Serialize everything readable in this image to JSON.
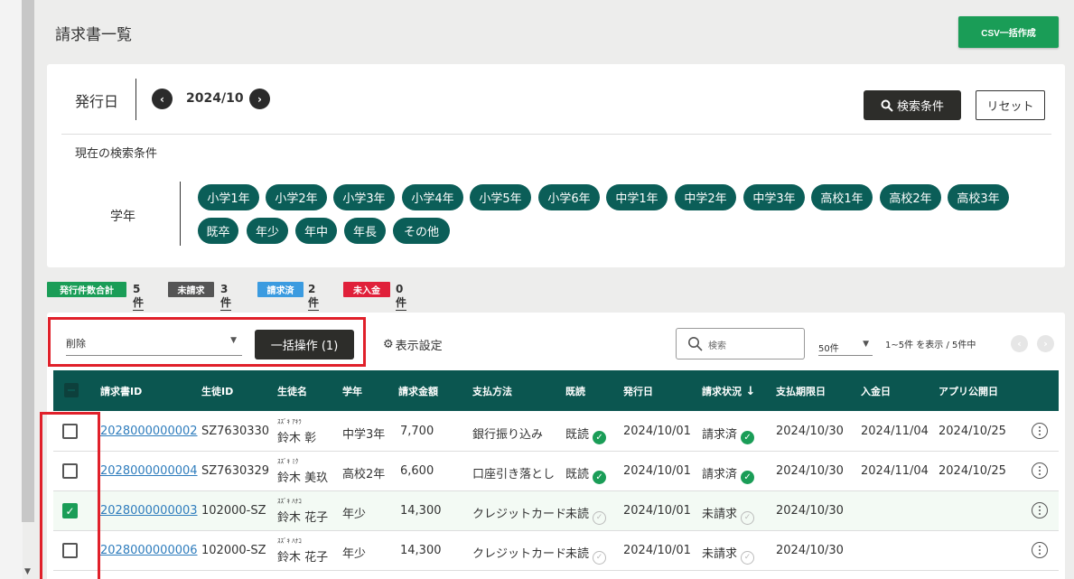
{
  "page": {
    "title": "請求書一覧",
    "csv_button": "CSV一括作成"
  },
  "search": {
    "date_label": "発行日",
    "current_date": "2024/10",
    "search_button": "検索条件",
    "reset_button": "リセット",
    "conditions_label": "現在の検索条件",
    "grade_label": "学年",
    "grade_chips": [
      "小学1年",
      "小学2年",
      "小学3年",
      "小学4年",
      "小学5年",
      "小学6年",
      "中学1年",
      "中学2年",
      "中学3年",
      "高校1年",
      "高校2年",
      "高校3年",
      "既卒",
      "年少",
      "年中",
      "年長",
      "その他"
    ]
  },
  "summary": [
    {
      "label": "発行件数合計",
      "count": "5件",
      "color": "#1a9d57"
    },
    {
      "label": "未請求",
      "count": "3件",
      "color": "#555555"
    },
    {
      "label": "請求済",
      "count": "2件",
      "color": "#3b9be0"
    },
    {
      "label": "未入金",
      "count": "0件",
      "color": "#e0203a"
    }
  ],
  "toolbar": {
    "bulk_select_value": "削除",
    "bulk_button": "一括操作 (1)",
    "display_settings": "表示設定",
    "search_placeholder": "検索",
    "per_page": "50件",
    "range_text": "1~5件 を表示 / 5件中"
  },
  "table": {
    "headers": [
      "請求書ID",
      "生徒ID",
      "生徒名",
      "学年",
      "請求金額",
      "支払方法",
      "既読",
      "発行日",
      "請求状況",
      "支払期限日",
      "入金日",
      "アプリ公開日"
    ],
    "rows": [
      {
        "checked": false,
        "invoice_id": "2028000000002",
        "student_id": "SZ7630330",
        "kana": "ｽｽﾞｷ ｱｷﾗ",
        "name": "鈴木 彰",
        "grade": "中学3年",
        "amount": "7,700",
        "payment": "銀行振り込み",
        "read": "既読",
        "read_ok": true,
        "issued": "2024/10/01",
        "status": "請求済",
        "status_ok": true,
        "due": "2024/10/30",
        "paid": "2024/11/04",
        "app_date": "2024/10/25"
      },
      {
        "checked": false,
        "invoice_id": "2028000000004",
        "student_id": "SZ7630329",
        "kana": "ｽｽﾞｷ ﾐｸ",
        "name": "鈴木 美玖",
        "grade": "高校2年",
        "amount": "6,600",
        "payment": "口座引き落とし",
        "read": "既読",
        "read_ok": true,
        "issued": "2024/10/01",
        "status": "請求済",
        "status_ok": true,
        "due": "2024/10/30",
        "paid": "2024/11/04",
        "app_date": "2024/10/25"
      },
      {
        "checked": true,
        "invoice_id": "2028000000003",
        "student_id": "102000-SZ",
        "kana": "ｽｽﾞｷ ﾊﾅｺ",
        "name": "鈴木 花子",
        "grade": "年少",
        "amount": "14,300",
        "payment": "クレジットカード",
        "read": "未読",
        "read_ok": false,
        "issued": "2024/10/01",
        "status": "未請求",
        "status_ok": false,
        "due": "2024/10/30",
        "paid": "",
        "app_date": ""
      },
      {
        "checked": false,
        "invoice_id": "2028000000006",
        "student_id": "102000-SZ",
        "kana": "ｽｽﾞｷ ﾊﾅｺ",
        "name": "鈴木 花子",
        "grade": "年少",
        "amount": "14,300",
        "payment": "クレジットカード",
        "read": "未読",
        "read_ok": false,
        "issued": "2024/10/01",
        "status": "未請求",
        "status_ok": false,
        "due": "2024/10/30",
        "paid": "",
        "app_date": ""
      }
    ]
  }
}
